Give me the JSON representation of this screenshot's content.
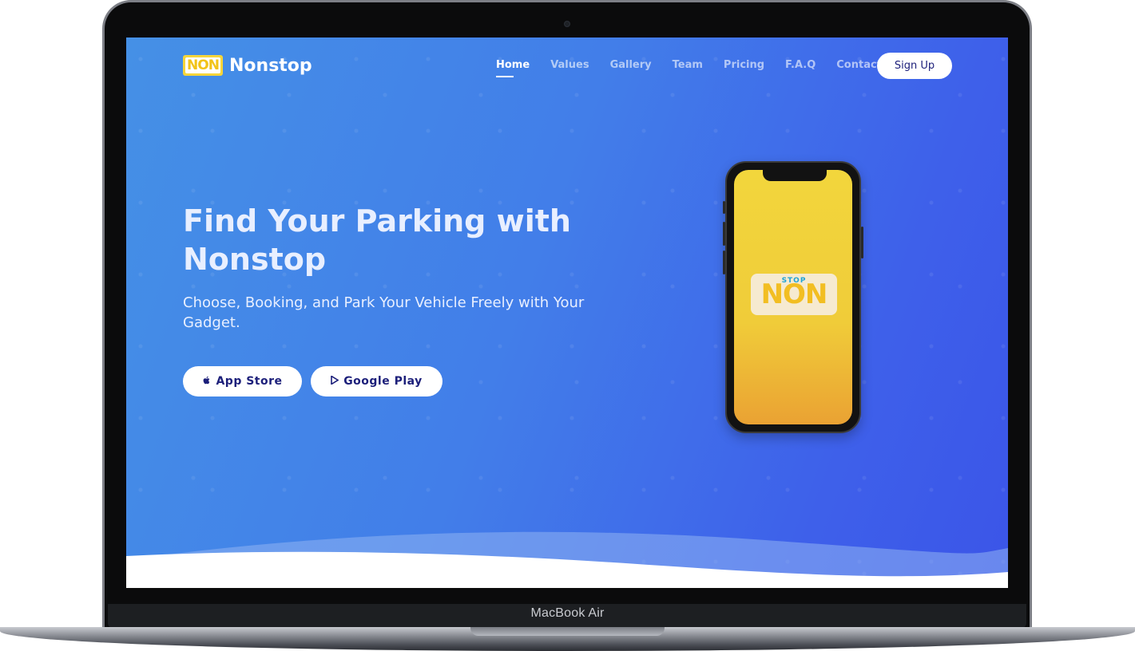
{
  "device": {
    "model_label": "MacBook Air"
  },
  "brand": {
    "logo_text": "NON",
    "logo_mark_small": "STOP",
    "name": "Nonstop"
  },
  "nav": {
    "items": [
      {
        "label": "Home",
        "active": true
      },
      {
        "label": "Values"
      },
      {
        "label": "Gallery"
      },
      {
        "label": "Team"
      },
      {
        "label": "Pricing"
      },
      {
        "label": "F.A.Q"
      },
      {
        "label": "Contact"
      }
    ],
    "signup_label": "Sign Up"
  },
  "hero": {
    "title": "Find Your Parking with Nonstop",
    "subtitle": "Choose, Booking, and Park Your Vehicle Freely with Your Gadget.",
    "app_store_label": "App Store",
    "google_play_label": "Google Play"
  },
  "phone": {
    "app_logo_text": "NON",
    "app_logo_small": "STOP"
  },
  "colors": {
    "gradient_start": "#4590e6",
    "gradient_end": "#3b55e8",
    "button_text": "#1c1f7a",
    "phone_screen": "#f2d63c",
    "logo_yellow": "#f5d53a"
  },
  "icons": {
    "apple": "apple-icon",
    "play": "play-icon"
  }
}
